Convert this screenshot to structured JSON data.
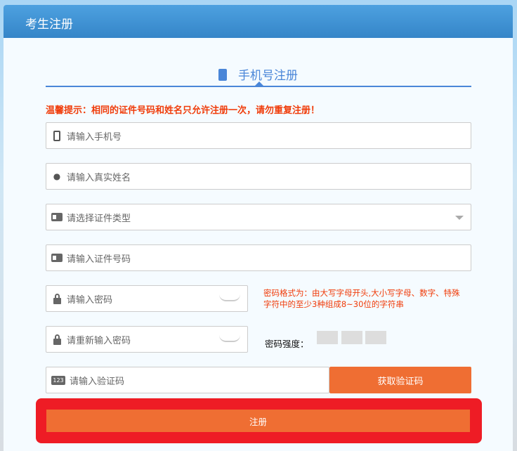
{
  "header": {
    "title": "考生注册"
  },
  "tab": {
    "label": "手机号注册"
  },
  "warning": "温馨提示：相同的证件号码和姓名只允许注册一次，请勿重复注册！",
  "fields": {
    "phone": "请输入手机号",
    "name": "请输入真实姓名",
    "id_type": "请选择证件类型",
    "id_no": "请输入证件号码",
    "password": "请输入密码",
    "repassword": "请重新输入密码",
    "captcha": "请输入验证码",
    "captcha_icon_text": "123"
  },
  "password_hint": "密码格式为：由大写字母开头,大小写字母、数字、特殊字符中的至少3种组成8~30位的字符串",
  "strength_label": "密码强度：",
  "get_code_button": "获取验证码",
  "register_button": "注册"
}
